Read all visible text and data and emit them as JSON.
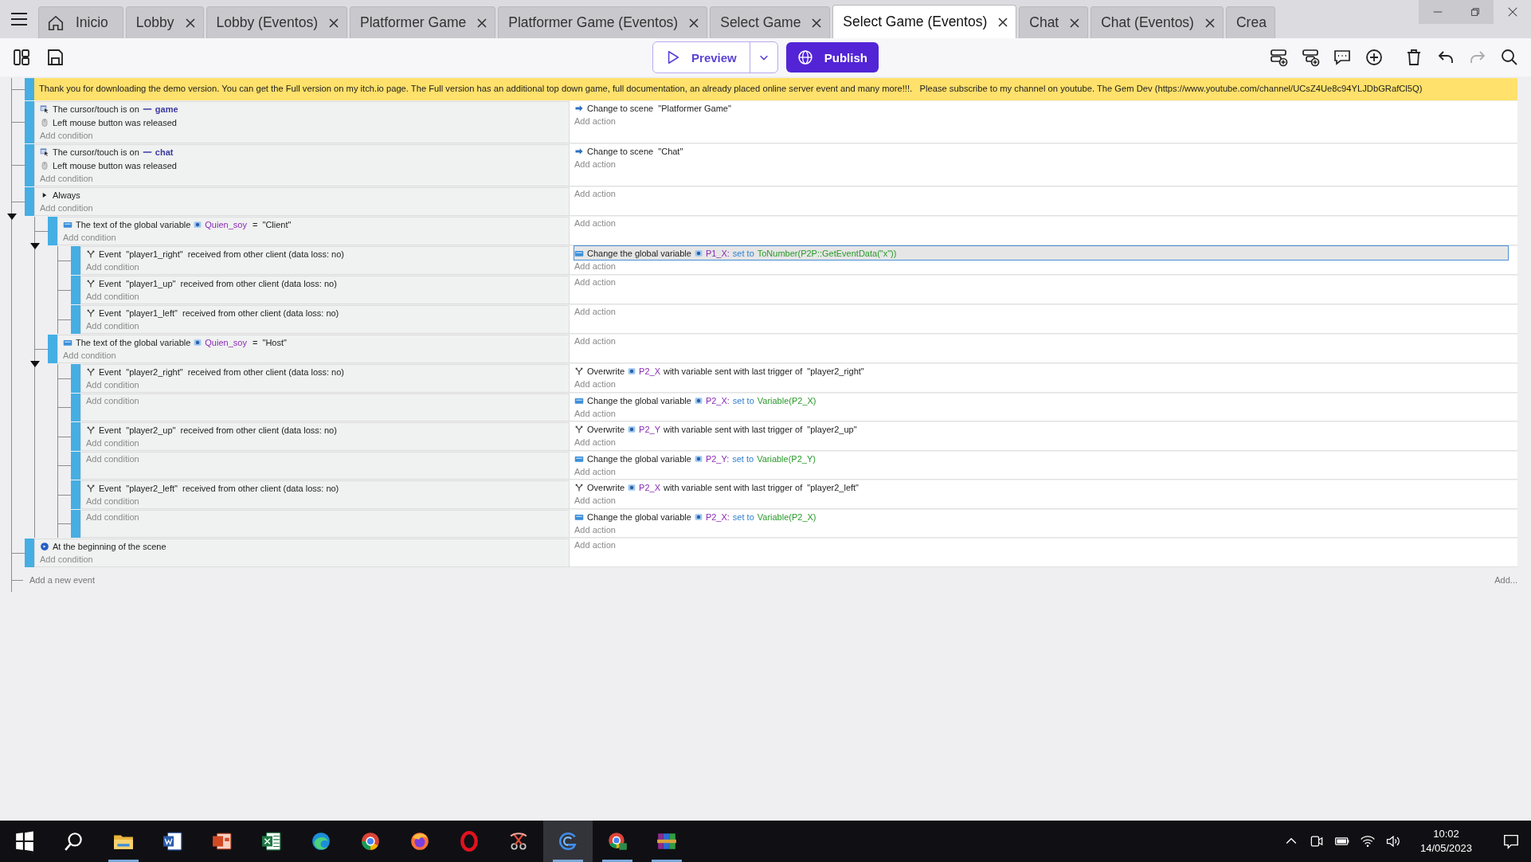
{
  "tabs": [
    {
      "label": "Inicio",
      "kind": "home",
      "closable": false,
      "selected": false
    },
    {
      "label": "Lobby",
      "kind": "editor",
      "closable": true,
      "selected": false
    },
    {
      "label": "Lobby (Eventos)",
      "kind": "editor",
      "closable": true,
      "selected": false
    },
    {
      "label": "Platformer Game",
      "kind": "editor",
      "closable": true,
      "selected": false
    },
    {
      "label": "Platformer Game (Eventos)",
      "kind": "editor",
      "closable": true,
      "selected": false
    },
    {
      "label": "Select Game",
      "kind": "editor",
      "closable": true,
      "selected": false
    },
    {
      "label": "Select Game (Eventos)",
      "kind": "editor",
      "closable": true,
      "selected": true
    },
    {
      "label": "Chat",
      "kind": "editor",
      "closable": true,
      "selected": false
    },
    {
      "label": "Chat (Eventos)",
      "kind": "editor",
      "closable": true,
      "selected": false
    },
    {
      "label": "Crea",
      "kind": "editor",
      "closable": false,
      "selected": false
    }
  ],
  "toolbar": {
    "left_tools": [
      {
        "kind": "panels"
      },
      {
        "kind": "save"
      }
    ],
    "preview": "Preview",
    "publish": "Publish",
    "right_tools": [
      {
        "kind": "add-event",
        "disabled": false
      },
      {
        "kind": "add-subevent",
        "disabled": false
      },
      {
        "kind": "comment",
        "disabled": false
      },
      {
        "kind": "add",
        "disabled": false
      },
      {
        "kind": "delete",
        "disabled": false
      },
      {
        "kind": "undo",
        "disabled": false
      },
      {
        "kind": "redo",
        "disabled": true
      },
      {
        "kind": "search",
        "disabled": false
      }
    ]
  },
  "comment": "Thank you for downloading the demo version. You can get the Full version on my itch.io page. The Full version has an additional top down game, full documentation, an already placed online server event and many more!!!.   Please subscribe to my channel on youtube. The Gem Dev (https://www.youtube.com/channel/UCsZ4Ue8c94YLJDbGRafCl5Q)",
  "events": [
    {
      "conditions": [
        {
          "kind": "cursor",
          "segments": [
            {
              "kind": "plain",
              "text": "The cursor/touch is on"
            },
            {
              "kind": "object",
              "text": "game"
            }
          ]
        },
        {
          "kind": "mouse",
          "segments": [
            {
              "kind": "plain",
              "text": "Left mouse button was released"
            }
          ]
        }
      ],
      "add_condition": "Add condition",
      "actions": [
        {
          "kind": "scene",
          "selected": false,
          "segments": [
            {
              "kind": "plain",
              "text": "Change to scene  \"Platformer Game\""
            }
          ]
        }
      ],
      "add_action": "Add action"
    },
    {
      "conditions": [
        {
          "kind": "cursor",
          "segments": [
            {
              "kind": "plain",
              "text": "The cursor/touch is on"
            },
            {
              "kind": "object",
              "text": "chat"
            }
          ]
        },
        {
          "kind": "mouse",
          "segments": [
            {
              "kind": "plain",
              "text": "Left mouse button was released"
            }
          ]
        }
      ],
      "add_condition": "Add condition",
      "actions": [
        {
          "kind": "scene",
          "selected": false,
          "segments": [
            {
              "kind": "plain",
              "text": "Change to scene  \"Chat\""
            }
          ]
        }
      ],
      "add_action": "Add action"
    },
    {
      "conditions": [
        {
          "kind": "always",
          "segments": [
            {
              "kind": "plain",
              "text": "Always"
            }
          ]
        }
      ],
      "add_condition": "Add condition",
      "add_action": "Add action",
      "expanded": true,
      "children": [
        {
          "conditions": [
            {
              "kind": "variable",
              "segments": [
                {
                  "kind": "plain",
                  "text": "The text of the global variable"
                },
                {
                  "kind": "variable",
                  "text": "Quien_soy"
                },
                {
                  "kind": "plain",
                  "text": " =  \"Client\""
                }
              ]
            }
          ],
          "add_condition": "Add condition",
          "add_action": "Add action",
          "expanded": true,
          "children": [
            {
              "conditions": [
                {
                  "kind": "network",
                  "segments": [
                    {
                      "kind": "plain",
                      "text": "Event  \"player1_right\"  received from other client (data loss: no)"
                    }
                  ]
                }
              ],
              "add_condition": "Add condition",
              "actions": [
                {
                  "kind": "variable",
                  "selected": true,
                  "segments": [
                    {
                      "kind": "plain",
                      "text": "Change the global variable"
                    },
                    {
                      "kind": "variable",
                      "text": "P1_X:"
                    },
                    {
                      "kind": "keyword",
                      "text": "set to"
                    },
                    {
                      "kind": "expression",
                      "text": "ToNumber(P2P::GetEventData(\"x\"))"
                    }
                  ]
                }
              ],
              "add_action": "Add action"
            },
            {
              "conditions": [
                {
                  "kind": "network",
                  "segments": [
                    {
                      "kind": "plain",
                      "text": "Event  \"player1_up\"  received from other client (data loss: no)"
                    }
                  ]
                }
              ],
              "add_condition": "Add condition",
              "add_action": "Add action"
            },
            {
              "conditions": [
                {
                  "kind": "network",
                  "segments": [
                    {
                      "kind": "plain",
                      "text": "Event  \"player1_left\"  received from other client (data loss: no)"
                    }
                  ]
                }
              ],
              "add_condition": "Add condition",
              "add_action": "Add action"
            }
          ]
        },
        {
          "conditions": [
            {
              "kind": "variable",
              "segments": [
                {
                  "kind": "plain",
                  "text": "The text of the global variable"
                },
                {
                  "kind": "variable",
                  "text": "Quien_soy"
                },
                {
                  "kind": "plain",
                  "text": " =  \"Host\""
                }
              ]
            }
          ],
          "add_condition": "Add condition",
          "add_action": "Add action",
          "expanded": true,
          "children": [
            {
              "conditions": [
                {
                  "kind": "network",
                  "segments": [
                    {
                      "kind": "plain",
                      "text": "Event  \"player2_right\"  received from other client (data loss: no)"
                    }
                  ]
                }
              ],
              "add_condition": "Add condition",
              "actions": [
                {
                  "kind": "network",
                  "selected": false,
                  "segments": [
                    {
                      "kind": "plain",
                      "text": "Overwrite"
                    },
                    {
                      "kind": "variable",
                      "text": "P2_X"
                    },
                    {
                      "kind": "plain",
                      "text": "with variable sent with last trigger of  \"player2_right\""
                    }
                  ]
                }
              ],
              "add_action": "Add action"
            },
            {
              "add_condition": "Add condition",
              "actions": [
                {
                  "kind": "variable",
                  "selected": false,
                  "segments": [
                    {
                      "kind": "plain",
                      "text": "Change the global variable"
                    },
                    {
                      "kind": "variable",
                      "text": "P2_X:"
                    },
                    {
                      "kind": "keyword",
                      "text": "set to"
                    },
                    {
                      "kind": "expression",
                      "text": "Variable(P2_X)"
                    }
                  ]
                }
              ],
              "add_action": "Add action"
            },
            {
              "conditions": [
                {
                  "kind": "network",
                  "segments": [
                    {
                      "kind": "plain",
                      "text": "Event  \"player2_up\"  received from other client (data loss: no)"
                    }
                  ]
                }
              ],
              "add_condition": "Add condition",
              "actions": [
                {
                  "kind": "network",
                  "selected": false,
                  "segments": [
                    {
                      "kind": "plain",
                      "text": "Overwrite"
                    },
                    {
                      "kind": "variable",
                      "text": "P2_Y"
                    },
                    {
                      "kind": "plain",
                      "text": "with variable sent with last trigger of  \"player2_up\""
                    }
                  ]
                }
              ],
              "add_action": "Add action"
            },
            {
              "add_condition": "Add condition",
              "actions": [
                {
                  "kind": "variable",
                  "selected": false,
                  "segments": [
                    {
                      "kind": "plain",
                      "text": "Change the global variable"
                    },
                    {
                      "kind": "variable",
                      "text": "P2_Y:"
                    },
                    {
                      "kind": "keyword",
                      "text": "set to"
                    },
                    {
                      "kind": "expression",
                      "text": "Variable(P2_Y)"
                    }
                  ]
                }
              ],
              "add_action": "Add action"
            },
            {
              "conditions": [
                {
                  "kind": "network",
                  "segments": [
                    {
                      "kind": "plain",
                      "text": "Event  \"player2_left\"  received from other client (data loss: no)"
                    }
                  ]
                }
              ],
              "add_condition": "Add condition",
              "actions": [
                {
                  "kind": "network",
                  "selected": false,
                  "segments": [
                    {
                      "kind": "plain",
                      "text": "Overwrite"
                    },
                    {
                      "kind": "variable",
                      "text": "P2_X"
                    },
                    {
                      "kind": "plain",
                      "text": "with variable sent with last trigger of  \"player2_left\""
                    }
                  ]
                }
              ],
              "add_action": "Add action"
            },
            {
              "add_condition": "Add condition",
              "actions": [
                {
                  "kind": "variable",
                  "selected": false,
                  "segments": [
                    {
                      "kind": "plain",
                      "text": "Change the global variable"
                    },
                    {
                      "kind": "variable",
                      "text": "P2_X:"
                    },
                    {
                      "kind": "keyword",
                      "text": "set to"
                    },
                    {
                      "kind": "expression",
                      "text": "Variable(P2_X)"
                    }
                  ]
                }
              ],
              "add_action": "Add action"
            }
          ]
        }
      ]
    },
    {
      "conditions": [
        {
          "kind": "scene-start",
          "segments": [
            {
              "kind": "plain",
              "text": "At the beginning of the scene"
            }
          ]
        }
      ],
      "add_condition": "Add condition",
      "add_action": "Add action"
    }
  ],
  "add_event": "Add a new event",
  "add_more": "Add...",
  "taskbar": {
    "apps": [
      {
        "kind": "start",
        "open": false,
        "selected": false
      },
      {
        "kind": "search",
        "open": false,
        "selected": false
      },
      {
        "kind": "folder",
        "open": true,
        "selected": false
      },
      {
        "kind": "word",
        "open": false,
        "selected": false
      },
      {
        "kind": "slides",
        "open": false,
        "selected": false
      },
      {
        "kind": "sheet",
        "open": false,
        "selected": false
      },
      {
        "kind": "edge",
        "open": false,
        "selected": false
      },
      {
        "kind": "chrome",
        "open": false,
        "selected": false
      },
      {
        "kind": "firefox",
        "open": false,
        "selected": false
      },
      {
        "kind": "opera",
        "open": false,
        "selected": false
      },
      {
        "kind": "snip",
        "open": false,
        "selected": false
      },
      {
        "kind": "gdevelop",
        "open": true,
        "selected": true
      },
      {
        "kind": "chrome-app",
        "open": true,
        "selected": false
      },
      {
        "kind": "archive",
        "open": true,
        "selected": false
      }
    ],
    "time": "10:02",
    "date": "14/05/2023"
  }
}
